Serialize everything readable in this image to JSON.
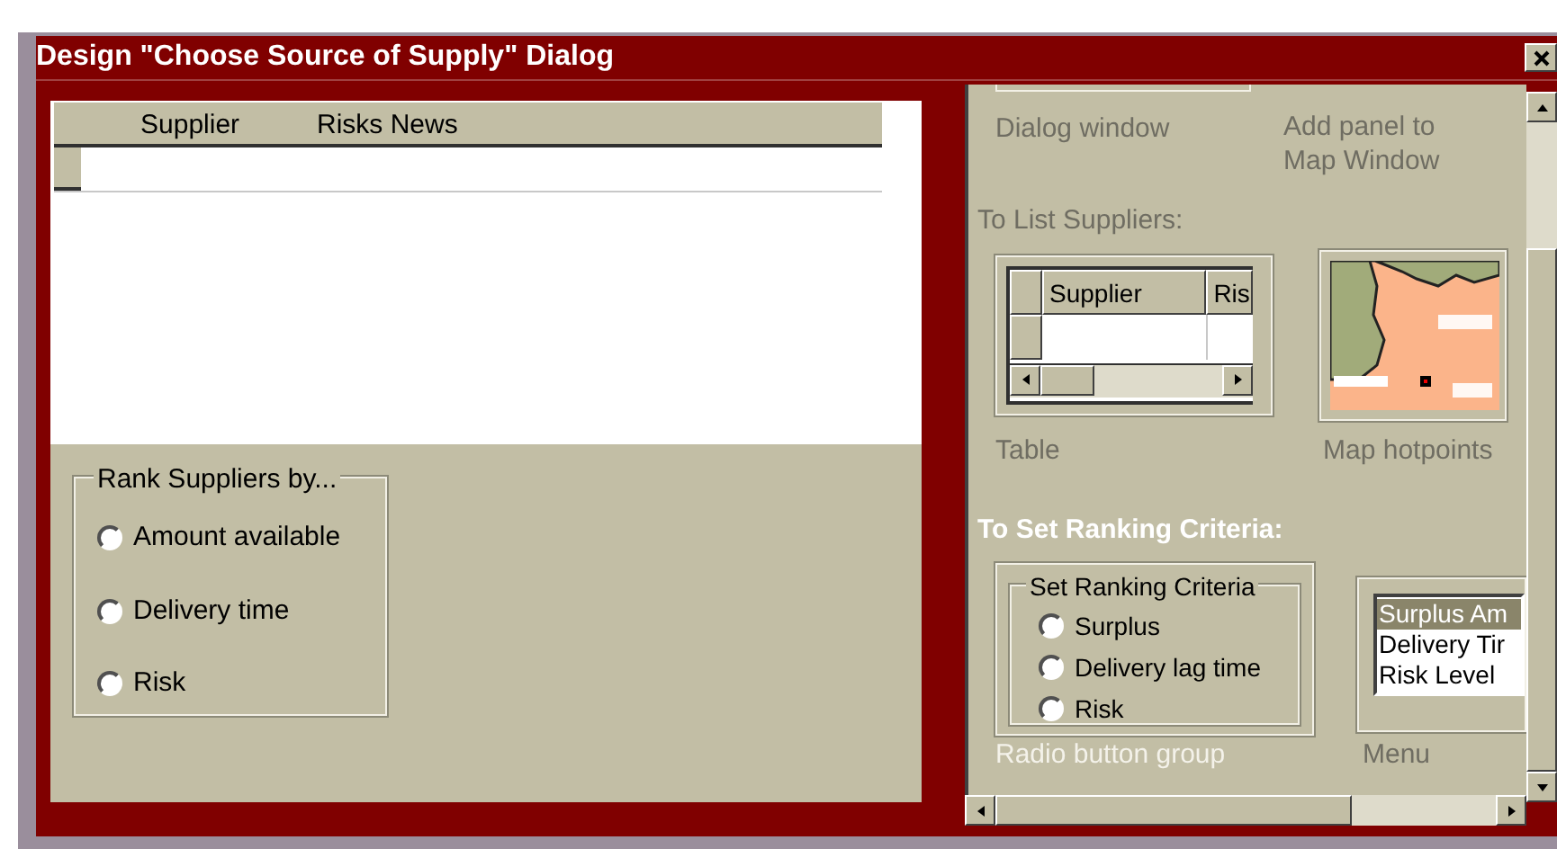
{
  "window": {
    "title": "Design \"Choose Source of Supply\" Dialog"
  },
  "suppliers_table": {
    "columns": [
      "Supplier",
      "Risks News"
    ]
  },
  "rank_group": {
    "label": "Rank Suppliers by...",
    "options": [
      {
        "label": "Amount available",
        "checked": false
      },
      {
        "label": "Delivery time",
        "checked": false
      },
      {
        "label": "Risk",
        "checked": false
      }
    ]
  },
  "design_notes": {
    "dialog_caption": "Dialog window",
    "map_panel_caption": "Add panel to Map Window",
    "list_heading": "To List Suppliers:",
    "table_sample": {
      "columns": [
        "Supplier",
        "Ris"
      ]
    },
    "table_caption": "Table",
    "map_caption": "Map hotpoints",
    "ranking_heading": "To Set Ranking Criteria:",
    "radio_group": {
      "label": "Set Ranking Criteria",
      "options": [
        {
          "label": "Surplus",
          "checked": false
        },
        {
          "label": "Delivery lag time",
          "checked": false
        },
        {
          "label": "Risk",
          "checked": false
        }
      ]
    },
    "menu_items": [
      {
        "label": "Surplus Am",
        "selected": true
      },
      {
        "label": "Delivery Tir",
        "selected": false
      },
      {
        "label": "Risk Level",
        "selected": false
      }
    ],
    "radio_caption": "Radio button group",
    "menu_caption": "Menu"
  }
}
